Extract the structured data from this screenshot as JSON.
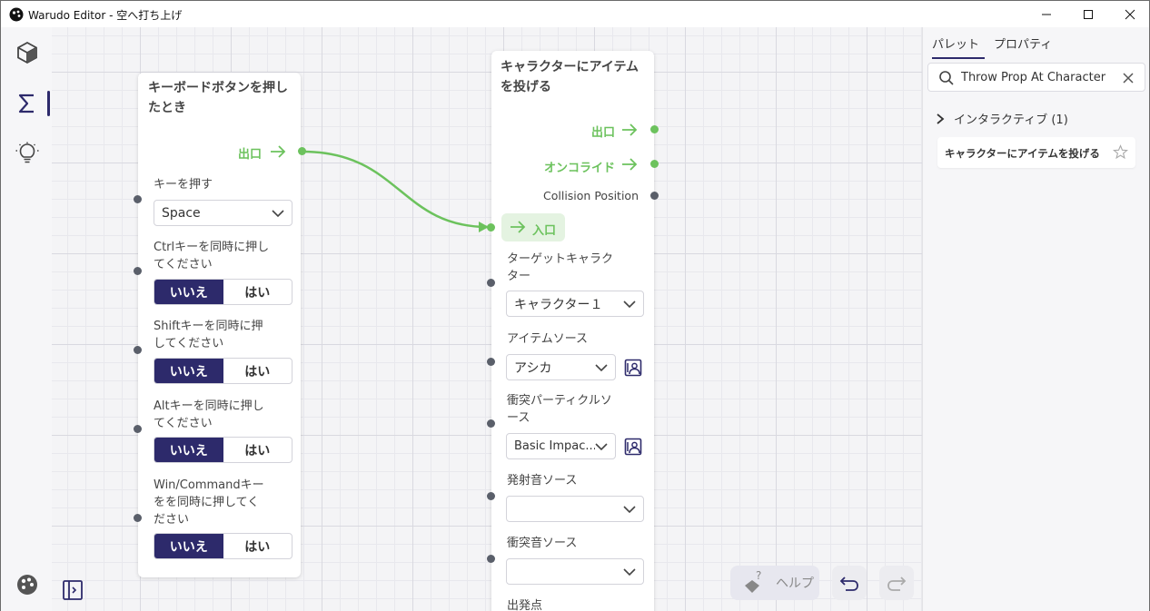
{
  "window": {
    "title": "Warudo Editor - 空へ打ち上げ"
  },
  "node_left": {
    "title": "キーボードボタンを押し\nたとき",
    "flow_out": "出口",
    "key_label": "キーを押す",
    "key_value": "Space",
    "ctrl_label": "Ctrlキーを同時に押し\nてください",
    "shift_label": "Shiftキーを同時に押\nしてください",
    "alt_label": "Altキーを同時に押し\nてください",
    "win_label": "Win/Commandキー\nをを同時に押してく\nださい",
    "toggle_no": "いいえ",
    "toggle_yes": "はい"
  },
  "node_right": {
    "title": "キャラクターにアイテム\nを投げる",
    "flow_out": "出口",
    "flow_override": "オンコライド",
    "collision_position": "Collision Position",
    "flow_in": "入口",
    "target_label": "ターゲットキャラク\nター",
    "target_value": "キャラクター１",
    "item_label": "アイテムソース",
    "item_value": "アシカ",
    "particle_label": "衝突パーティクルソ\nース",
    "particle_value": "Basic Impac...",
    "launch_sound_label": "発射音ソース",
    "launch_sound_value": "",
    "impact_sound_label": "衝突音ソース",
    "impact_sound_value": "",
    "origin_label": "出発点"
  },
  "toolbar": {
    "help_label": "ヘルプ"
  },
  "panel": {
    "tab_palette": "パレット",
    "tab_properties": "プロパティ",
    "search_value": "Throw Prop At Character",
    "category": "インタラクティブ (1)",
    "result": "キャラクターにアイテムを投げる"
  },
  "colors": {
    "accent": "#2d2a6b",
    "flow": "#6cc25d",
    "port": "#5a5f6a"
  }
}
